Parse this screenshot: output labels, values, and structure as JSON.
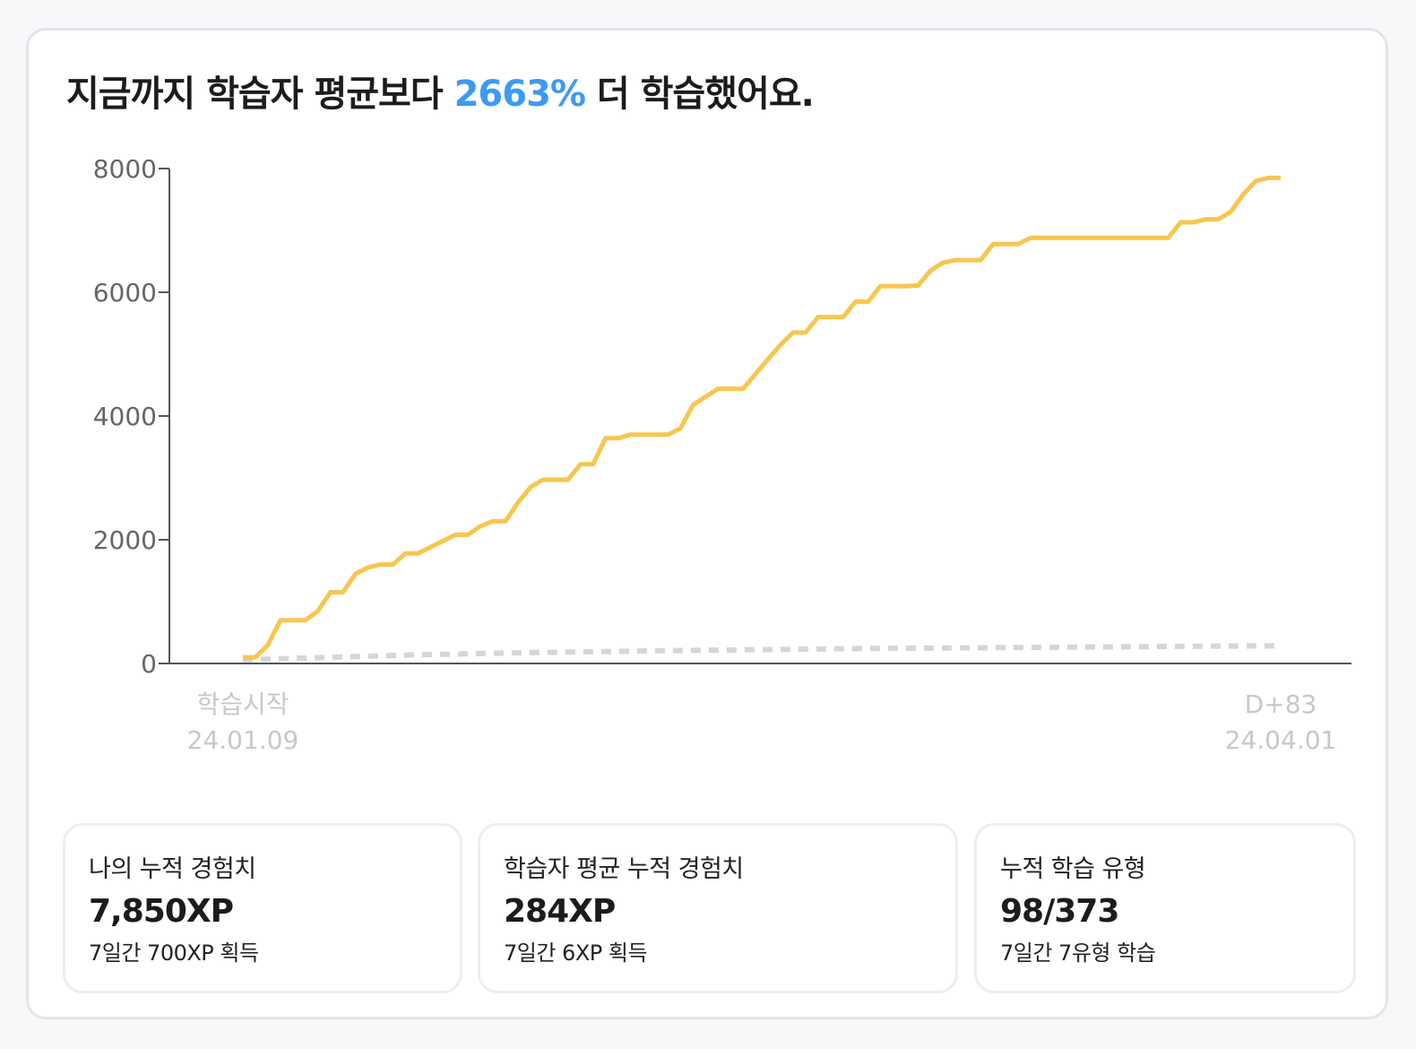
{
  "headline": {
    "prefix": "지금까지 학습자 평균보다 ",
    "highlight": "2663%",
    "suffix": " 더 학습했어요.",
    "accent_color": "#3d9af2"
  },
  "chart_data": {
    "type": "line",
    "title": "",
    "xlabel": "",
    "ylabel": "",
    "ylim": [
      0,
      8000
    ],
    "y_ticks": [
      "0",
      "2000",
      "4000",
      "6000",
      "8000"
    ],
    "x_range": [
      "24.01.09",
      "24.04.01"
    ],
    "x_labels": [
      {
        "lines": [
          "학습시작",
          "24.01.09"
        ],
        "date": "24.01.09"
      },
      {
        "lines": [
          "D+83",
          "24.04.01"
        ],
        "date": "24.04.01"
      }
    ],
    "grid": false,
    "legend": "none",
    "series": [
      {
        "color": "#f7c64f",
        "style": "solid",
        "x": [
          "24.01.09",
          "24.01.10",
          "24.01.11",
          "24.01.12",
          "24.01.13",
          "24.01.14",
          "24.01.15",
          "24.01.16",
          "24.01.17",
          "24.01.18",
          "24.01.19",
          "24.01.20",
          "24.01.21",
          "24.01.22",
          "24.01.23",
          "24.01.24",
          "24.01.25",
          "24.01.26",
          "24.01.27",
          "24.01.28",
          "24.01.29",
          "24.01.30",
          "24.01.31",
          "24.02.01",
          "24.02.02",
          "24.02.03",
          "24.02.04",
          "24.02.05",
          "24.02.06",
          "24.02.07",
          "24.02.08",
          "24.02.09",
          "24.02.10",
          "24.02.11",
          "24.02.12",
          "24.02.13",
          "24.02.14",
          "24.02.15",
          "24.02.16",
          "24.02.17",
          "24.02.18",
          "24.02.19",
          "24.02.20",
          "24.02.21",
          "24.02.22",
          "24.02.23",
          "24.02.24",
          "24.02.25",
          "24.02.26",
          "24.02.27",
          "24.02.28",
          "24.02.29",
          "24.03.01",
          "24.03.02",
          "24.03.03",
          "24.03.04",
          "24.03.05",
          "24.03.06",
          "24.03.07",
          "24.03.08",
          "24.03.09",
          "24.03.10",
          "24.03.11",
          "24.03.12",
          "24.03.13",
          "24.03.14",
          "24.03.15",
          "24.03.16",
          "24.03.17",
          "24.03.18",
          "24.03.19",
          "24.03.20",
          "24.03.21",
          "24.03.22",
          "24.03.23",
          "24.03.24",
          "24.03.25",
          "24.03.26",
          "24.03.27",
          "24.03.28",
          "24.03.29",
          "24.03.30",
          "24.03.31",
          "24.04.01"
        ],
        "values": [
          100,
          100,
          300,
          700,
          700,
          700,
          850,
          1150,
          1150,
          1450,
          1550,
          1600,
          1600,
          1780,
          1780,
          1880,
          1980,
          2080,
          2080,
          2220,
          2300,
          2300,
          2600,
          2850,
          2970,
          2970,
          2970,
          3220,
          3220,
          3640,
          3640,
          3700,
          3700,
          3700,
          3700,
          3800,
          4180,
          4310,
          4440,
          4440,
          4440,
          4680,
          4920,
          5150,
          5350,
          5350,
          5600,
          5600,
          5600,
          5850,
          5850,
          6100,
          6100,
          6100,
          6110,
          6350,
          6480,
          6520,
          6520,
          6520,
          6780,
          6780,
          6780,
          6880,
          6880,
          6880,
          6880,
          6880,
          6880,
          6880,
          6880,
          6880,
          6880,
          6880,
          6880,
          7130,
          7130,
          7180,
          7180,
          7300,
          7580,
          7800,
          7850,
          7850
        ]
      },
      {
        "color": "#d6d6d6",
        "style": "dashed",
        "x": [
          "24.01.09",
          "24.01.16",
          "24.01.23",
          "24.01.30",
          "24.02.06",
          "24.02.13",
          "24.02.20",
          "24.02.27",
          "24.03.05",
          "24.03.12",
          "24.03.19",
          "24.03.26",
          "24.04.01"
        ],
        "values": [
          60,
          100,
          140,
          170,
          190,
          210,
          225,
          240,
          250,
          260,
          270,
          280,
          284
        ]
      }
    ]
  },
  "stats": [
    {
      "label": "나의 누적 경험치",
      "value": "7,850XP",
      "sub": "7일간 700XP 획득"
    },
    {
      "label": "학습자 평균 누적 경험치",
      "value": "284XP",
      "sub": "7일간 6XP 획득"
    },
    {
      "label": "누적 학습 유형",
      "value": "98/373",
      "sub": "7일간 7유형 학습"
    }
  ]
}
